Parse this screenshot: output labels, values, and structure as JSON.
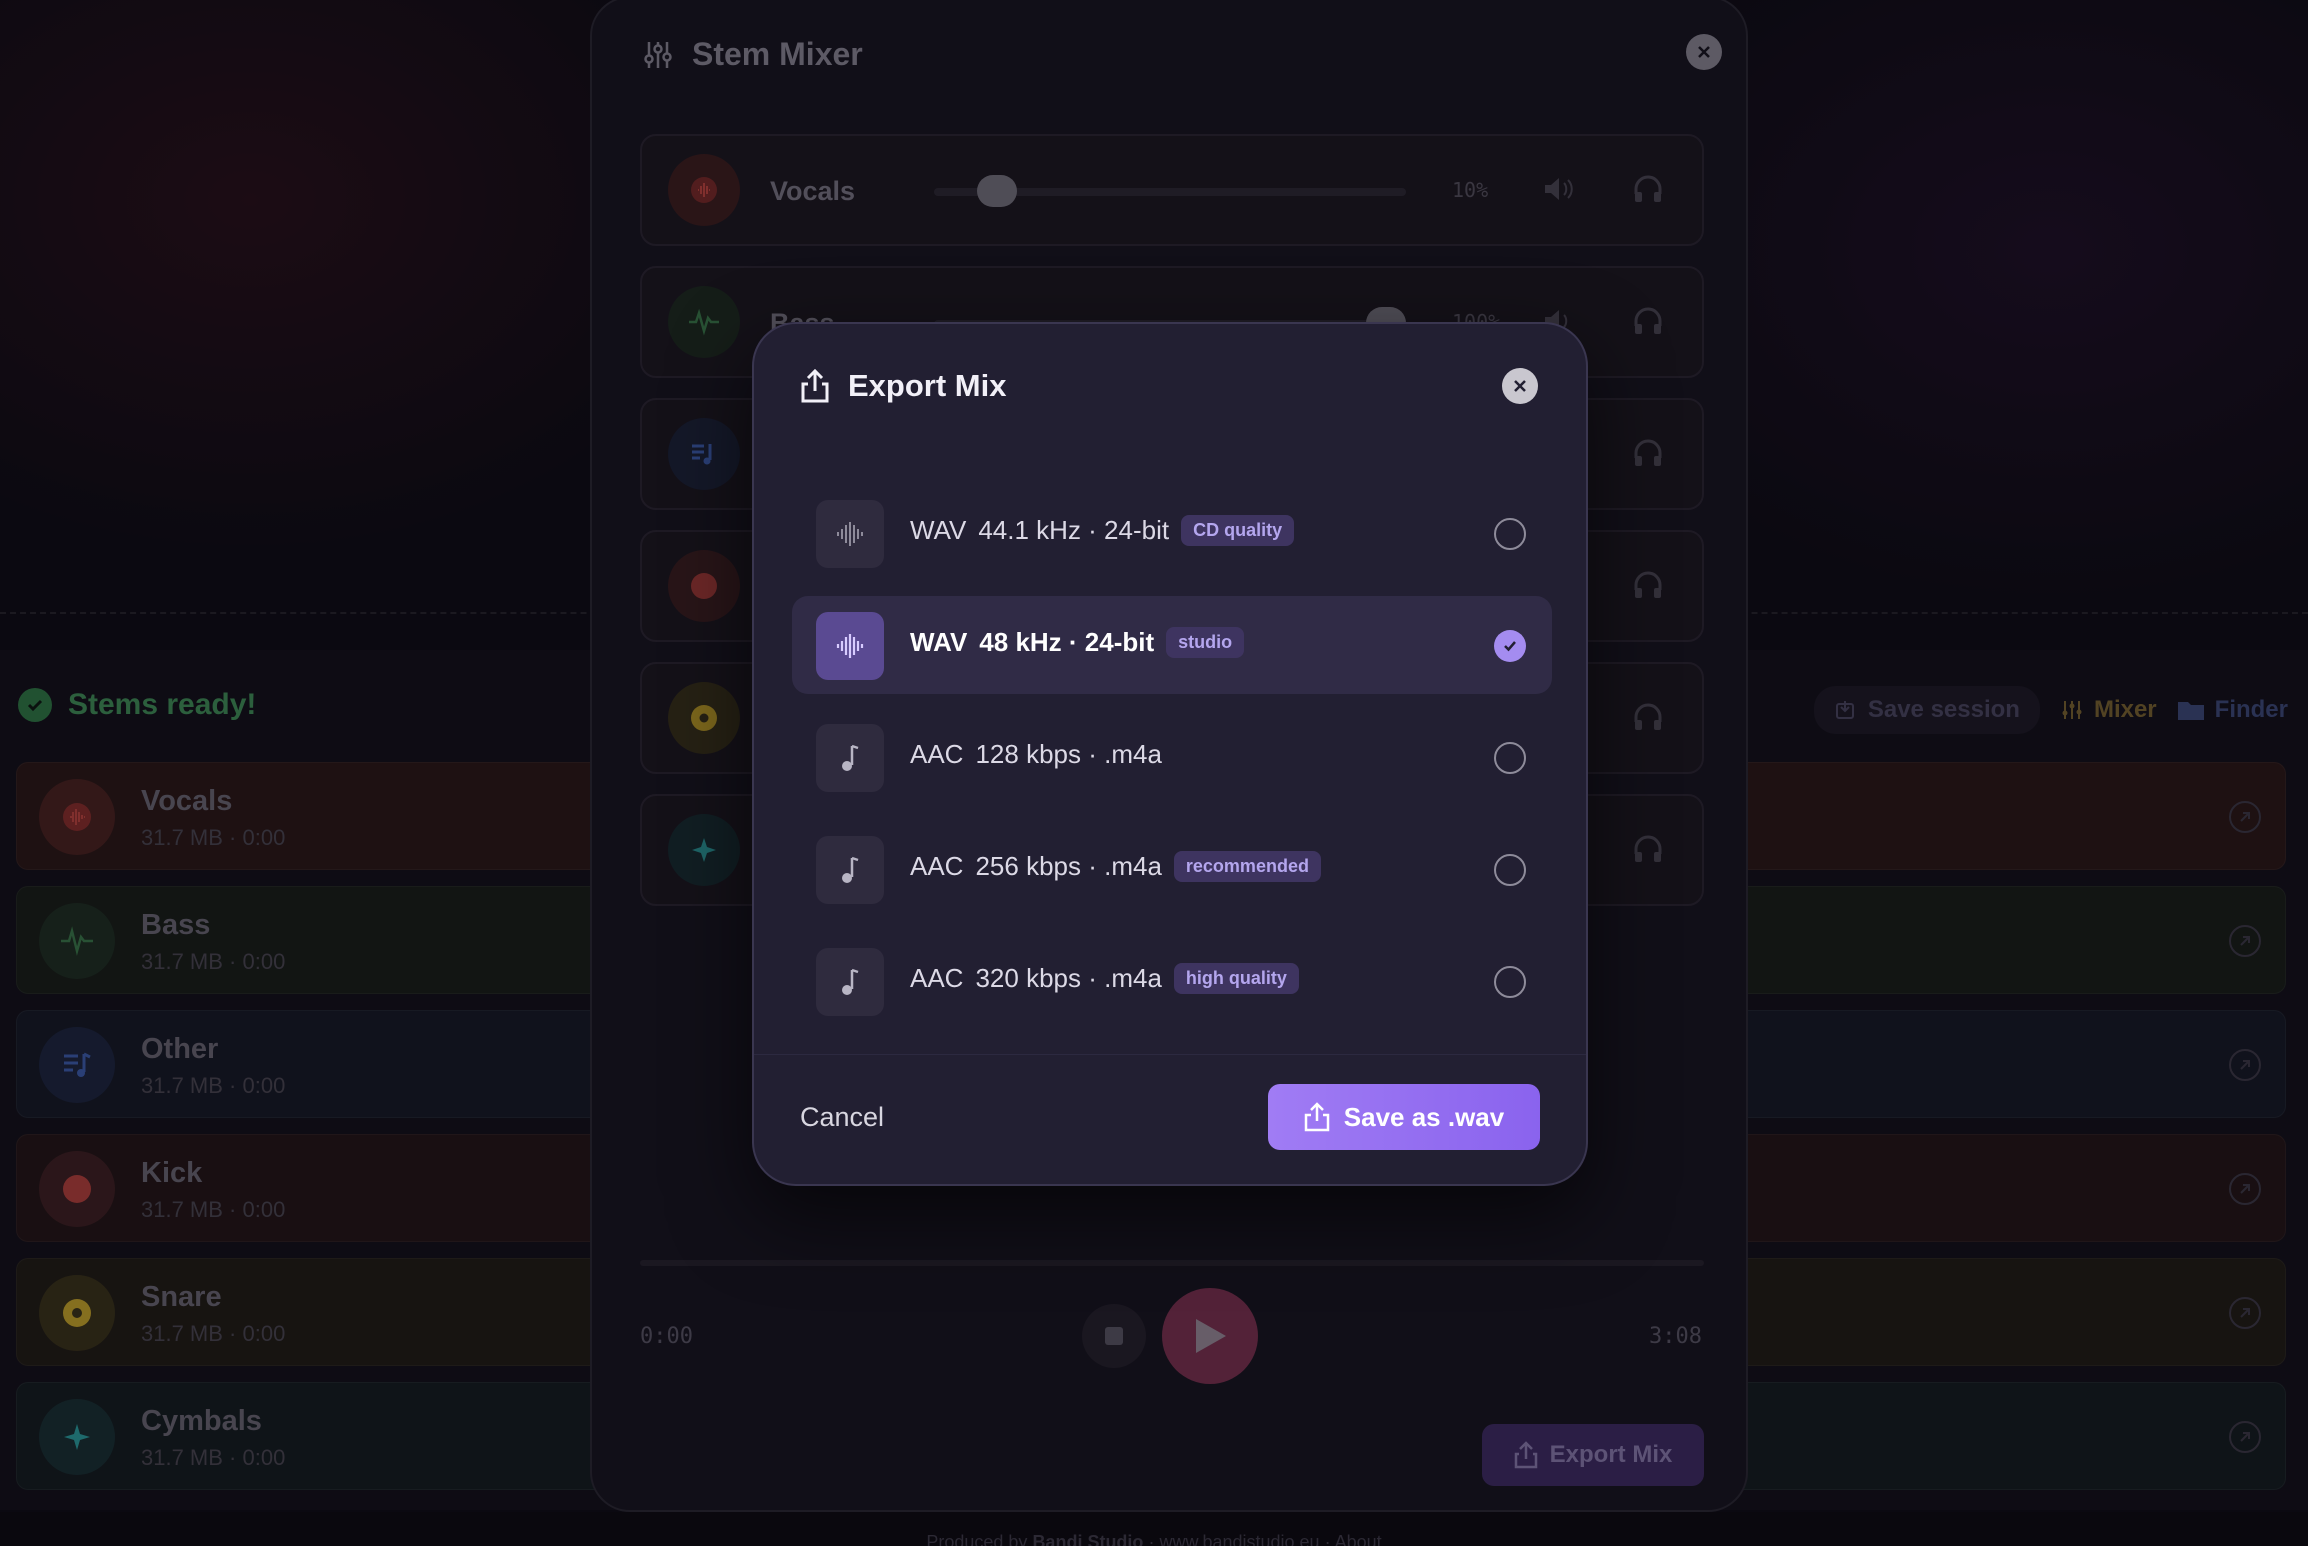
{
  "footer": {
    "prefix": "Produced by",
    "brand": "Bandi Studio",
    "sep1": "·",
    "site": "www.bandistudio.eu",
    "sep2": "·",
    "about": "About"
  },
  "stems_section": {
    "title": "Stems ready!",
    "save_session": "Save session",
    "mixer": "Mixer",
    "finder": "Finder",
    "rows": [
      {
        "name": "Vocals",
        "meta": "31.7 MB · 0:00"
      },
      {
        "name": "Bass",
        "meta": "31.7 MB · 0:00"
      },
      {
        "name": "Other",
        "meta": "31.7 MB · 0:00"
      },
      {
        "name": "Kick",
        "meta": "31.7 MB · 0:00"
      },
      {
        "name": "Snare",
        "meta": "31.7 MB · 0:00"
      },
      {
        "name": "Cymbals",
        "meta": "31.7 MB · 0:00"
      }
    ]
  },
  "mixer": {
    "title": "Stem Mixer",
    "tracks": [
      {
        "name": "Vocals",
        "level_pct": "10%",
        "level": 0.1
      },
      {
        "name": "Bass",
        "level_pct": "100%",
        "level": 1.0
      }
    ],
    "time_start": "0:00",
    "time_end": "3:08",
    "export_button": "Export Mix"
  },
  "export_modal": {
    "title": "Export Mix",
    "options": [
      {
        "codec": "WAV",
        "spec": "44.1 kHz · 24-bit",
        "badge": "CD quality",
        "selected": false,
        "icon": "waveform-icon"
      },
      {
        "codec": "WAV",
        "spec": "48 kHz · 24-bit",
        "badge": "studio",
        "selected": true,
        "icon": "waveform-icon"
      },
      {
        "codec": "AAC",
        "spec": "128 kbps · .m4a",
        "badge": "",
        "selected": false,
        "icon": "music-note-icon"
      },
      {
        "codec": "AAC",
        "spec": "256 kbps · .m4a",
        "badge": "recommended",
        "selected": false,
        "icon": "music-note-icon"
      },
      {
        "codec": "AAC",
        "spec": "320 kbps · .m4a",
        "badge": "high quality",
        "selected": false,
        "icon": "music-note-icon"
      }
    ],
    "cancel": "Cancel",
    "save": "Save as .wav"
  },
  "colors": {
    "accent": "#9b78f2",
    "success": "#3f8f58",
    "vocals": "#c0453f",
    "bass": "#3a7a4a",
    "other": "#3c5fb0",
    "kick": "#c0453f",
    "snare": "#c8a82a",
    "cymbals": "#2aa0a0"
  }
}
